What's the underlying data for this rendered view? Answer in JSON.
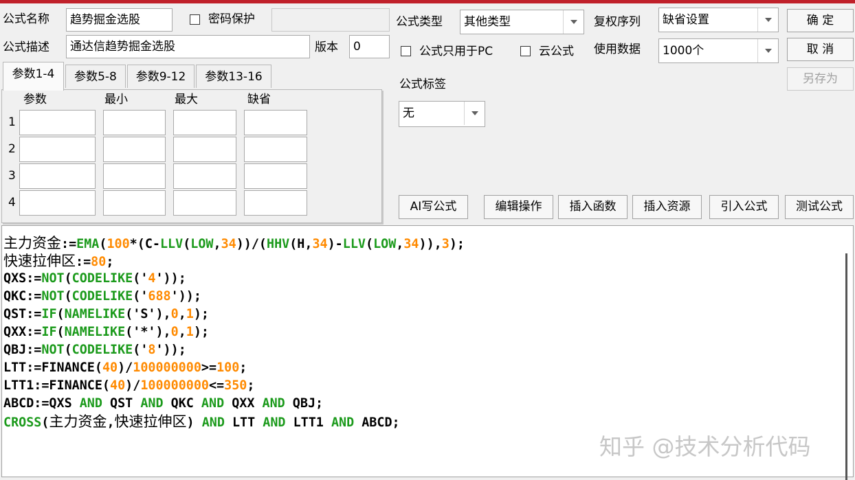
{
  "form": {
    "name_label": "公式名称",
    "name_value": "趋势掘金选股",
    "password_label": "密码保护",
    "password_value": "",
    "desc_label": "公式描述",
    "desc_value": "通达信趋势掘金选股",
    "version_label": "版本",
    "version_value": "0",
    "type_label": "公式类型",
    "type_value": "其他类型",
    "fq_label": "复权序列",
    "fq_value": "缺省设置",
    "pc_only_label": "公式只用于PC",
    "cloud_label": "云公式",
    "data_label": "使用数据",
    "data_value": "1000个",
    "tag_label": "公式标签",
    "tag_value": "无"
  },
  "buttons": {
    "ok": "确  定",
    "cancel": "取  消",
    "save_as": "另存为",
    "ai": "AI写公式",
    "edit": "编辑操作",
    "insert_func": "插入函数",
    "insert_res": "插入资源",
    "import": "引入公式",
    "test": "测试公式"
  },
  "params": {
    "tabs": [
      "参数1-4",
      "参数5-8",
      "参数9-12",
      "参数13-16"
    ],
    "headers": [
      "参数",
      "最小",
      "最大",
      "缺省"
    ],
    "rows": [
      "1",
      "2",
      "3",
      "4"
    ]
  },
  "code_lines": [
    [
      [
        "d",
        "主力资金"
      ],
      [
        "d",
        ":="
      ],
      [
        "f",
        "EMA"
      ],
      [
        "d",
        "("
      ],
      [
        "n",
        "100"
      ],
      [
        "d",
        "*(C-"
      ],
      [
        "f",
        "LLV"
      ],
      [
        "d",
        "("
      ],
      [
        "f",
        "LOW"
      ],
      [
        "d",
        ","
      ],
      [
        "n",
        "34"
      ],
      [
        "d",
        "))/("
      ],
      [
        "f",
        "HHV"
      ],
      [
        "d",
        "(H,"
      ],
      [
        "n",
        "34"
      ],
      [
        "d",
        ")-"
      ],
      [
        "f",
        "LLV"
      ],
      [
        "d",
        "("
      ],
      [
        "f",
        "LOW"
      ],
      [
        "d",
        ","
      ],
      [
        "n",
        "34"
      ],
      [
        "d",
        ")),"
      ],
      [
        "n",
        "3"
      ],
      [
        "d",
        ");"
      ]
    ],
    [
      [
        "d",
        "快速拉伸区"
      ],
      [
        "d",
        ":="
      ],
      [
        "n",
        "80"
      ],
      [
        "d",
        ";"
      ]
    ],
    [
      [
        "d",
        "QXS:="
      ],
      [
        "f",
        "NOT"
      ],
      [
        "d",
        "("
      ],
      [
        "f",
        "CODELIKE"
      ],
      [
        "d",
        "('"
      ],
      [
        "n",
        "4"
      ],
      [
        "d",
        "'));"
      ]
    ],
    [
      [
        "d",
        "QKC:="
      ],
      [
        "f",
        "NOT"
      ],
      [
        "d",
        "("
      ],
      [
        "f",
        "CODELIKE"
      ],
      [
        "d",
        "('"
      ],
      [
        "n",
        "688"
      ],
      [
        "d",
        "'));"
      ]
    ],
    [
      [
        "d",
        "QST:="
      ],
      [
        "f",
        "IF"
      ],
      [
        "d",
        "("
      ],
      [
        "f",
        "NAMELIKE"
      ],
      [
        "d",
        "('S'),"
      ],
      [
        "n",
        "0"
      ],
      [
        "d",
        ","
      ],
      [
        "n",
        "1"
      ],
      [
        "d",
        ");"
      ]
    ],
    [
      [
        "d",
        "QXX:="
      ],
      [
        "f",
        "IF"
      ],
      [
        "d",
        "("
      ],
      [
        "f",
        "NAMELIKE"
      ],
      [
        "d",
        "('*'),"
      ],
      [
        "n",
        "0"
      ],
      [
        "d",
        ","
      ],
      [
        "n",
        "1"
      ],
      [
        "d",
        ");"
      ]
    ],
    [
      [
        "d",
        "QBJ:="
      ],
      [
        "f",
        "NOT"
      ],
      [
        "d",
        "("
      ],
      [
        "f",
        "CODELIKE"
      ],
      [
        "d",
        "('"
      ],
      [
        "n",
        "8"
      ],
      [
        "d",
        "'));"
      ]
    ],
    [
      [
        "d",
        "LTT:=FINANCE("
      ],
      [
        "n",
        "40"
      ],
      [
        "d",
        ")/"
      ],
      [
        "n",
        "100000000"
      ],
      [
        "d",
        ">="
      ],
      [
        "n",
        "100"
      ],
      [
        "d",
        ";"
      ]
    ],
    [
      [
        "d",
        "LTT1:=FINANCE("
      ],
      [
        "n",
        "40"
      ],
      [
        "d",
        ")/"
      ],
      [
        "n",
        "100000000"
      ],
      [
        "d",
        "<="
      ],
      [
        "n",
        "350"
      ],
      [
        "d",
        ";"
      ]
    ],
    [
      [
        "d",
        "ABCD:=QXS "
      ],
      [
        "f",
        "AND"
      ],
      [
        "d",
        " QST "
      ],
      [
        "f",
        "AND"
      ],
      [
        "d",
        " QKC "
      ],
      [
        "f",
        "AND"
      ],
      [
        "d",
        " QXX "
      ],
      [
        "f",
        "AND"
      ],
      [
        "d",
        " QBJ;"
      ]
    ],
    [
      [
        "f",
        "CROSS"
      ],
      [
        "d",
        "(主力资金,快速拉伸区) "
      ],
      [
        "f",
        "AND"
      ],
      [
        "d",
        " LTT "
      ],
      [
        "f",
        "AND"
      ],
      [
        "d",
        " LTT1 "
      ],
      [
        "f",
        "AND"
      ],
      [
        "d",
        " ABCD;"
      ]
    ]
  ],
  "watermark": "知乎 @技术分析代码",
  "colors": {
    "title_bar": "#c0202a",
    "function": "#1b9a1b",
    "number": "#ff8a00",
    "default": "#000000"
  }
}
